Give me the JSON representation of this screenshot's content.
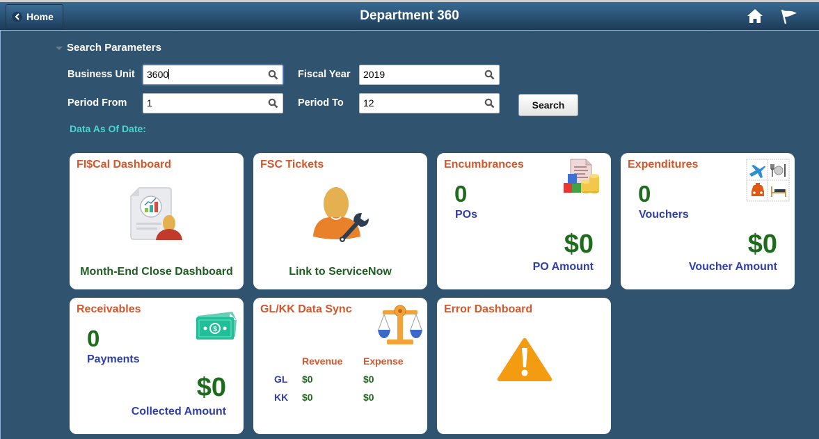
{
  "header": {
    "title": "Department 360",
    "home_label": "Home",
    "icons": [
      "home-icon",
      "flag-icon"
    ]
  },
  "search": {
    "section_title": "Search Parameters",
    "fields": {
      "business_unit": {
        "label": "Business Unit",
        "value": "3600"
      },
      "fiscal_year": {
        "label": "Fiscal Year",
        "value": "2019"
      },
      "period_from": {
        "label": "Period From",
        "value": "1"
      },
      "period_to": {
        "label": "Period To",
        "value": "12"
      }
    },
    "search_button": "Search",
    "data_as_of": "Data As Of Date:"
  },
  "tiles": {
    "fiscal": {
      "title": "FI$Cal Dashboard",
      "link": "Month-End Close Dashboard"
    },
    "fsc": {
      "title": "FSC Tickets",
      "link": "Link to ServiceNow"
    },
    "encumbrances": {
      "title": "Encumbrances",
      "count": "0",
      "count_label": "POs",
      "amount": "$0",
      "amount_label": "PO Amount"
    },
    "expenditures": {
      "title": "Expenditures",
      "count": "0",
      "count_label": "Vouchers",
      "amount": "$0",
      "amount_label": "Voucher Amount"
    },
    "receivables": {
      "title": "Receivables",
      "count": "0",
      "count_label": "Payments",
      "amount": "$0",
      "amount_label": "Collected Amount"
    },
    "sync": {
      "title": "GL/KK Data Sync",
      "columns": [
        "Revenue",
        "Expense"
      ],
      "rows": [
        {
          "label": "GL",
          "revenue": "$0",
          "expense": "$0"
        },
        {
          "label": "KK",
          "revenue": "$0",
          "expense": "$0"
        }
      ]
    },
    "error": {
      "title": "Error Dashboard"
    }
  },
  "colors": {
    "background": "#30536f",
    "tile_title": "#d5562a",
    "value_green": "#1f6b1d",
    "label_blue": "#2f3fad",
    "as_of_cyan": "#46d7d4"
  }
}
